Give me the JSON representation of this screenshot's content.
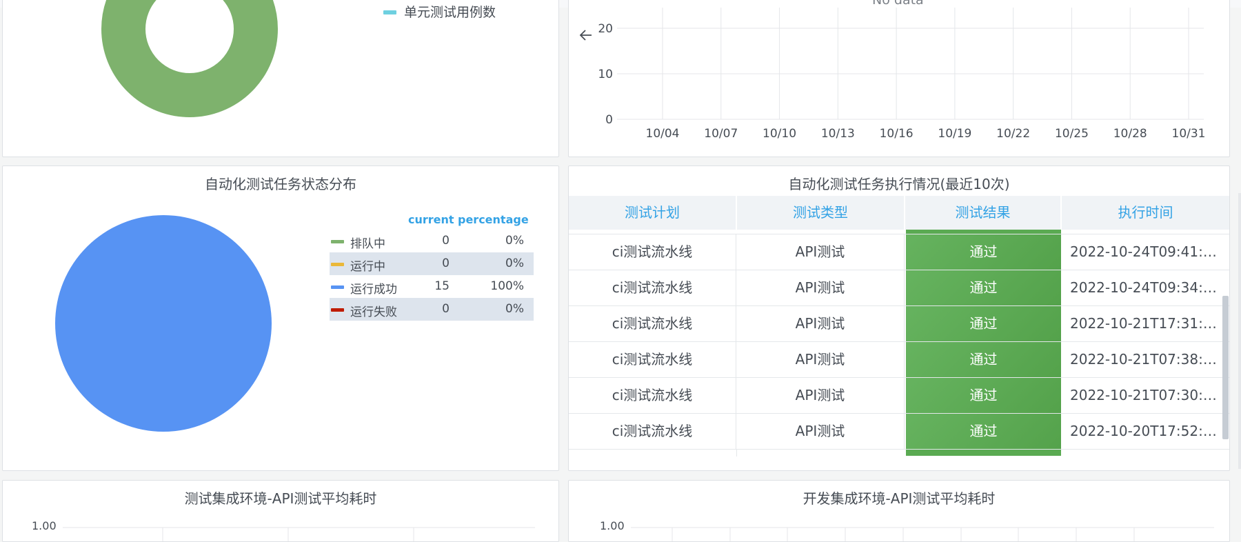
{
  "colors": {
    "accent": "#33a2e5",
    "green": "#7eb26d",
    "yellow": "#eab839",
    "blue": "#5793f3",
    "red": "#bf1b00",
    "cyan": "#6ed0e0",
    "pass": "#5aaa52"
  },
  "panel_top_left": {
    "legend_item": "单元测试用例数",
    "chart_data": {
      "type": "pie",
      "donut": true,
      "slices": [
        {
          "value": 100,
          "color": "#7eb26d"
        }
      ]
    }
  },
  "panel_top_right": {
    "no_data": "No data",
    "chart_data": {
      "type": "line",
      "x_ticks": [
        "10/04",
        "10/07",
        "10/10",
        "10/13",
        "10/16",
        "10/19",
        "10/22",
        "10/25",
        "10/28",
        "10/31"
      ],
      "y_ticks": [
        "20",
        "10",
        "0"
      ],
      "ylim": [
        0,
        20
      ],
      "series": []
    }
  },
  "panel_status": {
    "title": "自动化测试任务状态分布",
    "legend_headers": {
      "current": "current",
      "percentage": "percentage"
    },
    "legend": [
      {
        "name": "排队中",
        "current": "0",
        "percentage": "0%",
        "color": "#7eb26d"
      },
      {
        "name": "运行中",
        "current": "0",
        "percentage": "0%",
        "color": "#eab839"
      },
      {
        "name": "运行成功",
        "current": "15",
        "percentage": "100%",
        "color": "#5793f3"
      },
      {
        "name": "运行失败",
        "current": "0",
        "percentage": "0%",
        "color": "#bf1b00"
      }
    ],
    "chart_data": {
      "type": "pie",
      "slices": [
        {
          "name": "排队中",
          "value": 0,
          "color": "#7eb26d"
        },
        {
          "name": "运行中",
          "value": 0,
          "color": "#eab839"
        },
        {
          "name": "运行成功",
          "value": 15,
          "color": "#5793f3"
        },
        {
          "name": "运行失败",
          "value": 0,
          "color": "#bf1b00"
        }
      ]
    }
  },
  "panel_exec": {
    "title": "自动化测试任务执行情况(最近10次)",
    "columns": [
      "测试计划",
      "测试类型",
      "测试结果",
      "执行时间"
    ],
    "rows": [
      {
        "plan": "ci测试流水线",
        "type": "API测试",
        "result": "通过",
        "time": "2022-10-24T09:41:…"
      },
      {
        "plan": "ci测试流水线",
        "type": "API测试",
        "result": "通过",
        "time": "2022-10-24T09:34:…"
      },
      {
        "plan": "ci测试流水线",
        "type": "API测试",
        "result": "通过",
        "time": "2022-10-21T17:31:…"
      },
      {
        "plan": "ci测试流水线",
        "type": "API测试",
        "result": "通过",
        "time": "2022-10-21T07:38:…"
      },
      {
        "plan": "ci测试流水线",
        "type": "API测试",
        "result": "通过",
        "time": "2022-10-21T07:30:…"
      },
      {
        "plan": "ci测试流水线",
        "type": "API测试",
        "result": "通过",
        "time": "2022-10-20T17:52:…"
      }
    ]
  },
  "panel_test_env": {
    "title": "测试集成环境-API测试平均耗时",
    "y_top": "1.00"
  },
  "panel_dev_env": {
    "title": "开发集成环境-API测试平均耗时",
    "y_top": "1.00"
  }
}
